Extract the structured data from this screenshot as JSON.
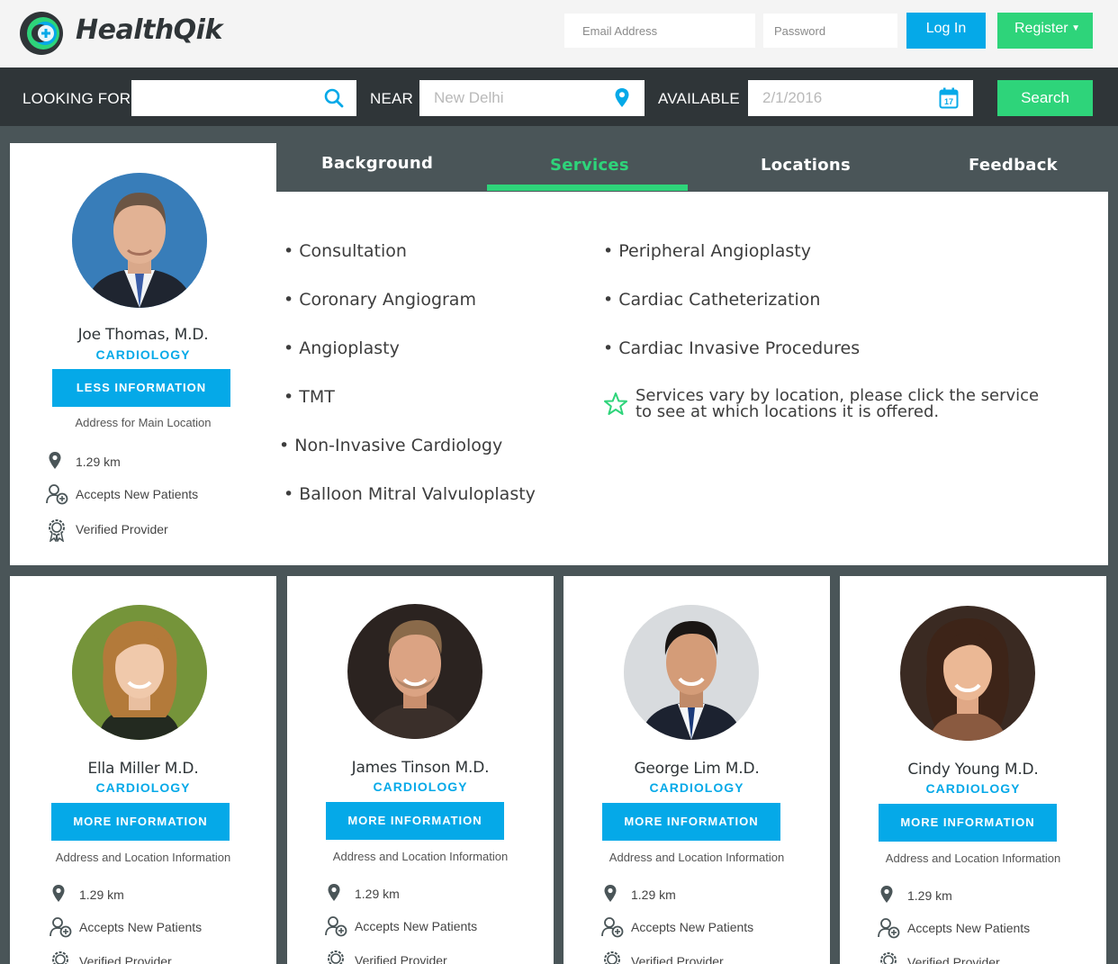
{
  "header": {
    "brand": "HealthQik",
    "email_placeholder": "Email Address",
    "password_placeholder": "Password",
    "login_label": "Log In",
    "register_label": "Register"
  },
  "search": {
    "looking_for_label": "LOOKING FOR",
    "looking_for_value": "",
    "near_label": "NEAR",
    "near_placeholder": "New Delhi",
    "available_label": "AVAILABLE",
    "available_placeholder": "2/1/2016",
    "calendar_day": "17",
    "search_label": "Search"
  },
  "featured": {
    "name": "Joe Thomas, M.D.",
    "specialty": "CARDIOLOGY",
    "button_label": "LESS INFORMATION",
    "address": "Address for Main Location",
    "distance": "1.29 km",
    "accepts": "Accepts New Patients",
    "verified": "Verified Provider",
    "tabs": [
      "Background",
      "Services",
      "Locations",
      "Feedback"
    ],
    "active_tab": "Services",
    "services_left": [
      "• Consultation",
      "• Coronary Angiogram",
      "• Angioplasty",
      "• TMT",
      "• Non-Invasive Cardiology",
      "• Balloon Mitral Valvuloplasty"
    ],
    "services_right": [
      "• Peripheral Angioplasty",
      "• Cardiac Catheterization",
      "• Cardiac Invasive Procedures"
    ],
    "note": "Services vary by location, please click the service to see at which locations it is offered."
  },
  "doctors": [
    {
      "name": "Ella Miller M.D.",
      "specialty": "CARDIOLOGY",
      "button_label": "MORE INFORMATION",
      "address": "Address and Location Information",
      "distance": "1.29 km",
      "accepts": "Accepts New Patients",
      "verified": "Verified Provider"
    },
    {
      "name": "James Tinson M.D.",
      "specialty": "CARDIOLOGY",
      "button_label": "MORE INFORMATION",
      "address": "Address and Location Information",
      "distance": "1.29 km",
      "accepts": "Accepts New Patients",
      "verified": "Verified Provider"
    },
    {
      "name": "George Lim M.D.",
      "specialty": "CARDIOLOGY",
      "button_label": "MORE INFORMATION",
      "address": "Address and Location Information",
      "distance": "1.29 km",
      "accepts": "Accepts New Patients",
      "verified": "Verified Provider"
    },
    {
      "name": "Cindy Young M.D.",
      "specialty": "CARDIOLOGY",
      "button_label": "MORE INFORMATION",
      "address": "Address and Location Information",
      "distance": "1.29 km",
      "accepts": "Accepts New Patients",
      "verified": "Verified Provider"
    }
  ],
  "colors": {
    "accent_blue": "#05a9e8",
    "accent_green": "#2ed47a",
    "dark_bar": "#2f3538",
    "page_bg": "#4a5558"
  },
  "icons": [
    "search-icon",
    "location-pin-icon",
    "calendar-icon",
    "user-add-icon",
    "award-ribbon-icon",
    "star-icon",
    "logo-icon",
    "caret-down-icon"
  ]
}
